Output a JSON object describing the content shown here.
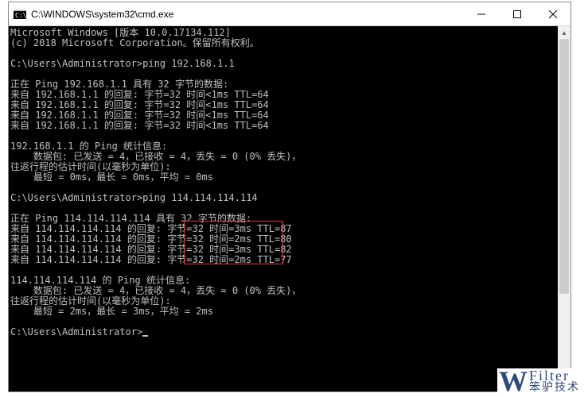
{
  "window": {
    "title": "C:\\WINDOWS\\system32\\cmd.exe"
  },
  "terminal": {
    "lines": [
      "Microsoft Windows [版本 10.0.17134.112]",
      "(c) 2018 Microsoft Corporation。保留所有权利。",
      "",
      "C:\\Users\\Administrator>ping 192.168.1.1",
      "",
      "正在 Ping 192.168.1.1 具有 32 字节的数据:",
      "来自 192.168.1.1 的回复: 字节=32 时间<1ms TTL=64",
      "来自 192.168.1.1 的回复: 字节=32 时间<1ms TTL=64",
      "来自 192.168.1.1 的回复: 字节=32 时间<1ms TTL=64",
      "来自 192.168.1.1 的回复: 字节=32 时间<1ms TTL=64",
      "",
      "192.168.1.1 的 Ping 统计信息:",
      "    数据包: 已发送 = 4，已接收 = 4，丢失 = 0 (0% 丢失)，",
      "往返行程的估计时间(以毫秒为单位):",
      "    最短 = 0ms，最长 = 0ms，平均 = 0ms",
      "",
      "C:\\Users\\Administrator>ping 114.114.114.114",
      "",
      "正在 Ping 114.114.114.114 具有 32 字节的数据:",
      "来自 114.114.114.114 的回复: 字节=32 时间=3ms TTL=87",
      "来自 114.114.114.114 的回复: 字节=32 时间=2ms TTL=80",
      "来自 114.114.114.114 的回复: 字节=32 时间=3ms TTL=82",
      "来自 114.114.114.114 的回复: 字节=32 时间=2ms TTL=77",
      "",
      "114.114.114.114 的 Ping 统计信息:",
      "    数据包: 已发送 = 4，已接收 = 4，丢失 = 0 (0% 丢失)，",
      "往返行程的估计时间(以毫秒为单位):",
      "    最短 = 2ms，最长 = 3ms，平均 = 2ms",
      "",
      "C:\\Users\\Administrator>"
    ],
    "prompt_cursor_line_index": 29
  },
  "highlight": {
    "note": "red annotation box around time/TTL values of 114.114.114.114 replies"
  },
  "watermark": {
    "glyph": "W",
    "line1": "Filter",
    "line2": "笨驴技术"
  }
}
